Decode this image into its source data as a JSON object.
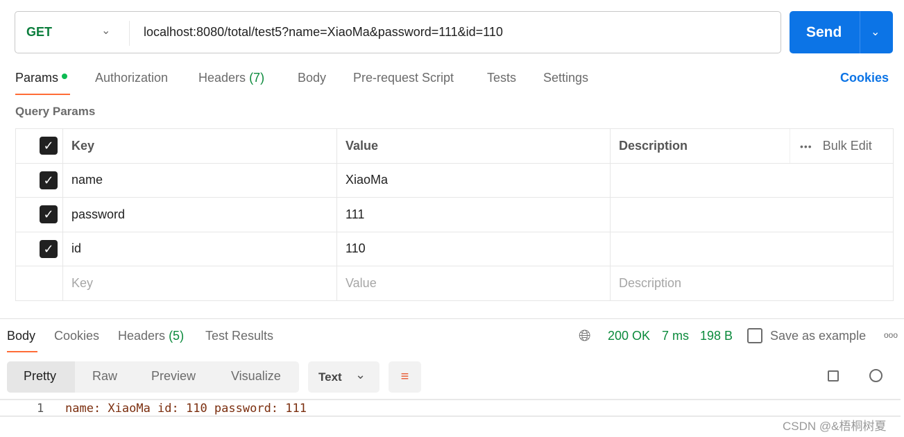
{
  "request": {
    "method": "GET",
    "url": "localhost:8080/total/test5?name=XiaoMa&password=111&id=110",
    "send_label": "Send"
  },
  "tabs": [
    {
      "label": "Params"
    },
    {
      "label": "Authorization"
    },
    {
      "label": "Headers",
      "count": "(7)"
    },
    {
      "label": "Body"
    },
    {
      "label": "Pre-request Script"
    },
    {
      "label": "Tests"
    },
    {
      "label": "Settings"
    }
  ],
  "cookies_link": "Cookies",
  "query_params": {
    "title": "Query Params",
    "headers": {
      "key": "Key",
      "value": "Value",
      "description": "Description",
      "bulk_edit": "Bulk Edit"
    },
    "rows": [
      {
        "key": "name",
        "value": "XiaoMa",
        "checked": true
      },
      {
        "key": "password",
        "value": "111",
        "checked": true
      },
      {
        "key": "id",
        "value": "110",
        "checked": true
      }
    ],
    "placeholders": {
      "key": "Key",
      "value": "Value",
      "description": "Description"
    }
  },
  "response": {
    "tabs": [
      {
        "label": "Body"
      },
      {
        "label": "Cookies"
      },
      {
        "label": "Headers",
        "count": "(5)"
      },
      {
        "label": "Test Results"
      }
    ],
    "status": "200 OK",
    "time": "7 ms",
    "size": "198 B",
    "save_label": "Save as example",
    "views": [
      "Pretty",
      "Raw",
      "Preview",
      "Visualize"
    ],
    "format": "Text",
    "lines": [
      {
        "num": "1",
        "text": "name: XiaoMa id: 110 password: 111"
      }
    ]
  },
  "watermark": "CSDN @&梧桐树夏",
  "colors": {
    "accent": "#0c74e6",
    "method": "#0b7d3c",
    "tab_underline": "#ff6c37",
    "status": "#0b8a3c"
  }
}
